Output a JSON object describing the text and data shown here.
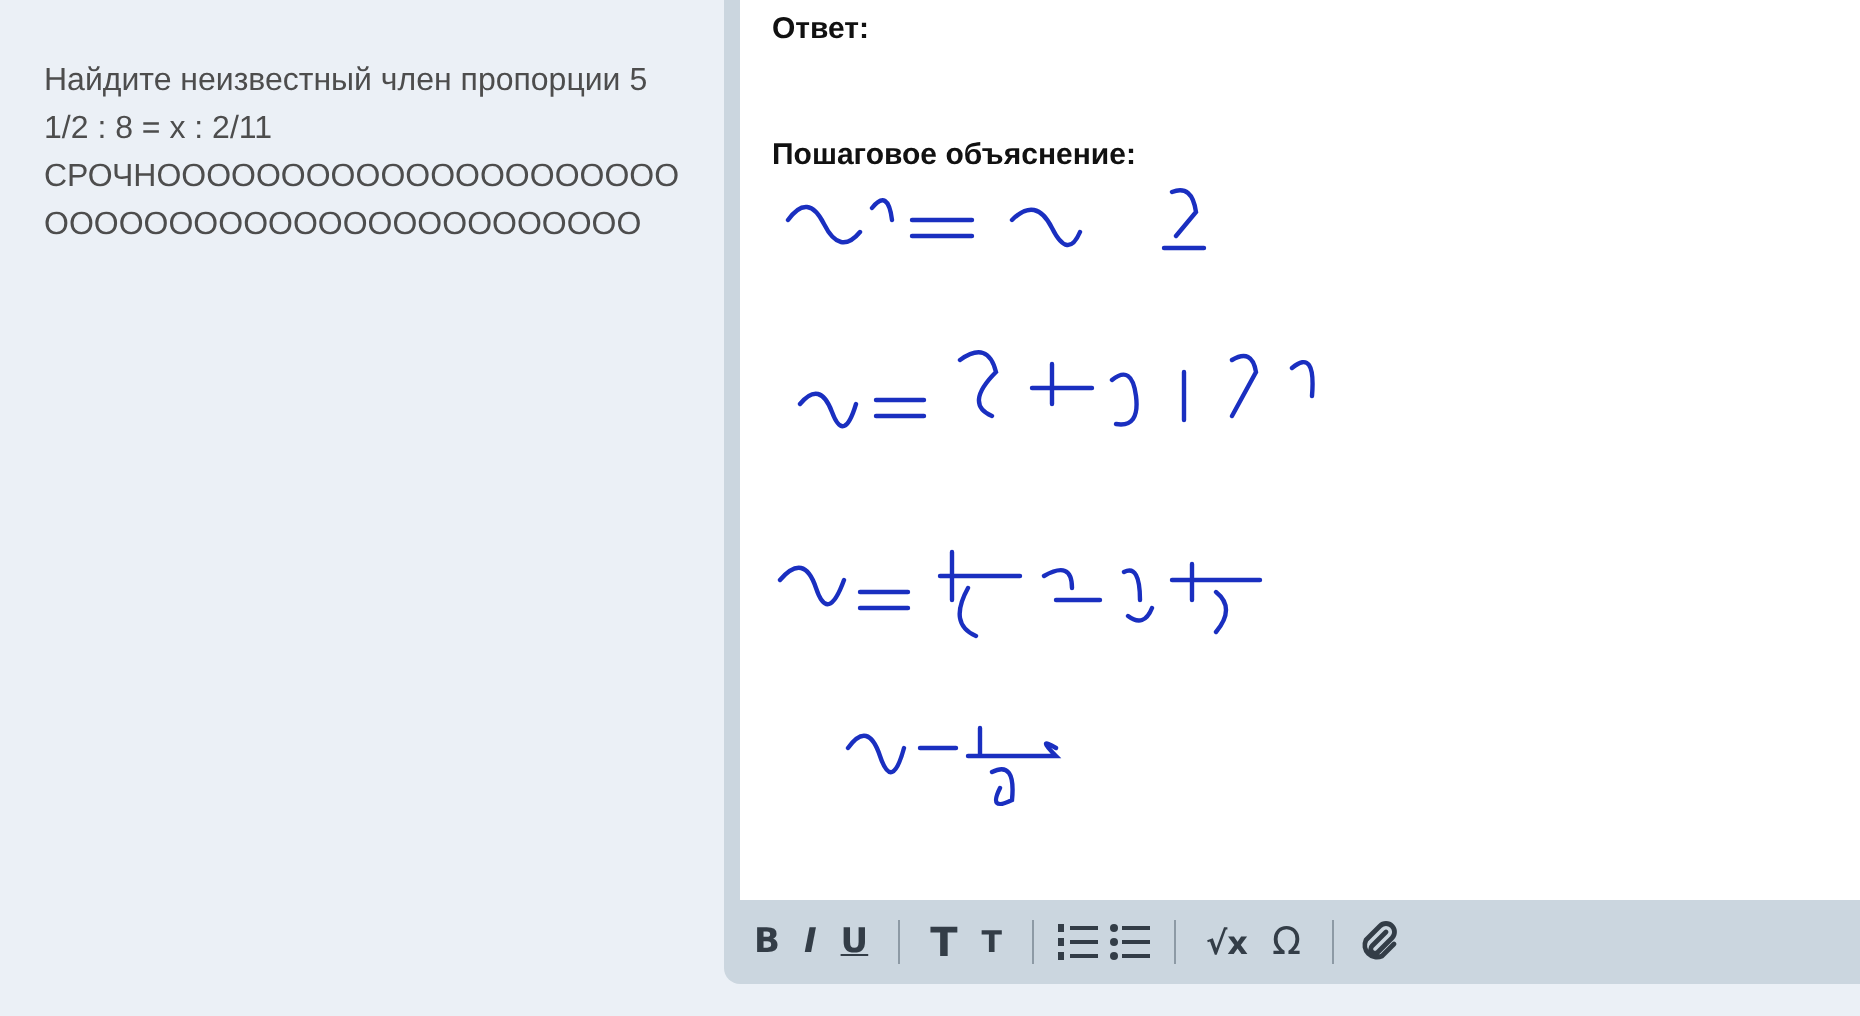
{
  "question": {
    "text": "Найдите неизвестный член пропорции 5 1/2 : 8 = x : 2/11 СРОЧНООООООООООООООООООООООООООООООООООООООООООООО"
  },
  "editor": {
    "answer_label": "Ответ:",
    "explanation_label": "Пошаговое объяснение:"
  },
  "toolbar": [
    [
      {
        "kind": "bold",
        "label": "B"
      },
      {
        "kind": "italic",
        "label": "I"
      },
      {
        "kind": "underline",
        "label": "U"
      }
    ],
    [
      {
        "kind": "large",
        "label": "T"
      },
      {
        "kind": "small",
        "label": "T"
      }
    ],
    [
      {
        "kind": "ordered-list"
      },
      {
        "kind": "bullet-list"
      }
    ],
    [
      {
        "kind": "formula",
        "label": "√x"
      },
      {
        "kind": "symbol",
        "label": "Ω"
      }
    ],
    [
      {
        "kind": "attach"
      }
    ]
  ]
}
